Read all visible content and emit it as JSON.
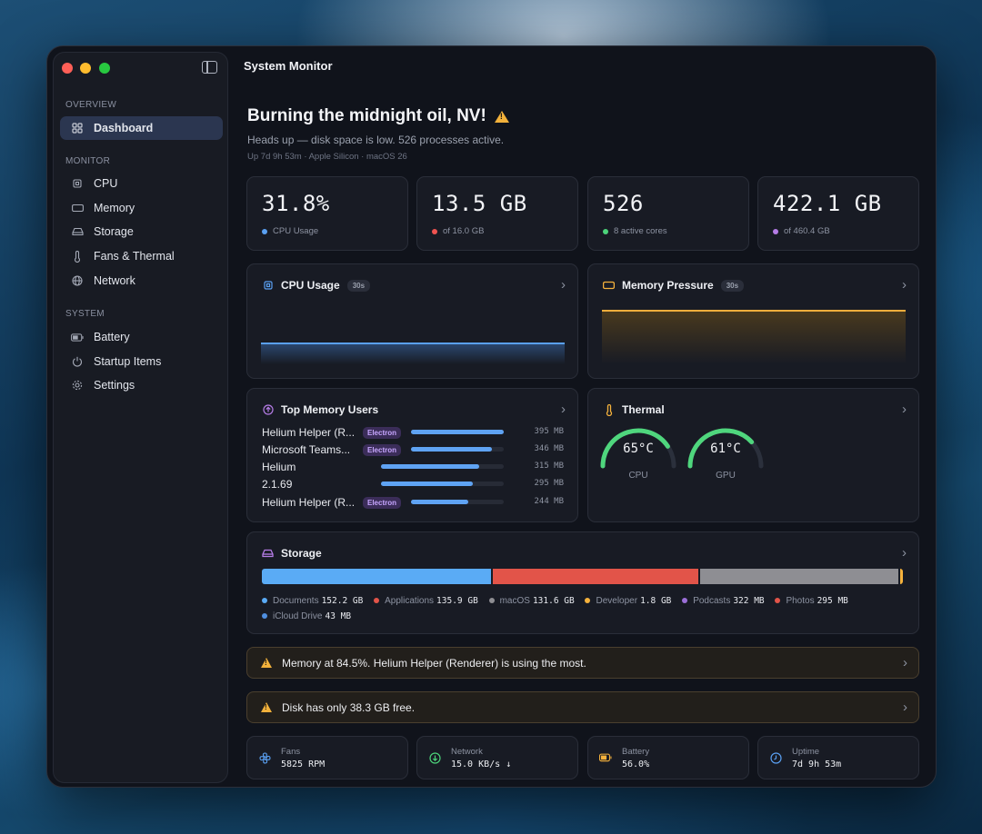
{
  "window": {
    "title": "System Monitor"
  },
  "sidebar": {
    "sections": [
      {
        "label": "OVERVIEW"
      },
      {
        "label": "MONITOR"
      },
      {
        "label": "SYSTEM"
      }
    ],
    "items": [
      {
        "label": "Dashboard",
        "icon": "grid-icon",
        "active": true
      },
      {
        "label": "CPU",
        "icon": "cpu-icon"
      },
      {
        "label": "Memory",
        "icon": "memory-icon"
      },
      {
        "label": "Storage",
        "icon": "storage-icon"
      },
      {
        "label": "Fans & Thermal",
        "icon": "thermometer-icon"
      },
      {
        "label": "Network",
        "icon": "globe-icon"
      },
      {
        "label": "Battery",
        "icon": "battery-icon"
      },
      {
        "label": "Startup Items",
        "icon": "power-icon"
      },
      {
        "label": "Settings",
        "icon": "gear-icon"
      }
    ]
  },
  "hero": {
    "title": "Burning the midnight oil, NV!",
    "subtitle": "Heads up — disk space is low. 526 processes active.",
    "meta": "Up 7d 9h 53m · Apple Silicon · macOS 26"
  },
  "stats": [
    {
      "value": "31.8%",
      "label": "CPU Usage",
      "color": "#5aa0f2"
    },
    {
      "value": "13.5 GB",
      "label": "of 16.0 GB",
      "color": "#ef5350"
    },
    {
      "value": "526",
      "label": "8 active cores",
      "color": "#4cd37a"
    },
    {
      "value": "422.1 GB",
      "label": "of 460.4 GB",
      "color": "#b57ce6"
    }
  ],
  "cpu_card": {
    "title": "CPU Usage",
    "window": "30s",
    "level": 0.318
  },
  "memory_card": {
    "title": "Memory Pressure",
    "window": "30s",
    "level": 0.845
  },
  "top_memory": {
    "title": "Top Memory Users",
    "rows": [
      {
        "name": "Helium Helper (R...",
        "tag": "Electron",
        "mb": "395 MB",
        "fraction": 1.0
      },
      {
        "name": "Microsoft Teams...",
        "tag": "Electron",
        "mb": "346 MB",
        "fraction": 0.876
      },
      {
        "name": "Helium",
        "tag": "",
        "mb": "315 MB",
        "fraction": 0.797
      },
      {
        "name": "2.1.69",
        "tag": "",
        "mb": "295 MB",
        "fraction": 0.747
      },
      {
        "name": "Helium Helper (R...",
        "tag": "Electron",
        "mb": "244 MB",
        "fraction": 0.618
      }
    ]
  },
  "thermal": {
    "title": "Thermal",
    "gauges": [
      {
        "value": "65°C",
        "label": "CPU",
        "fraction": 0.65
      },
      {
        "value": "61°C",
        "label": "GPU",
        "fraction": 0.61
      }
    ]
  },
  "storage": {
    "title": "Storage",
    "segments": [
      {
        "name": "Documents",
        "value": "152.2 GB",
        "gb": 152.2,
        "color": "#5aabf5"
      },
      {
        "name": "Applications",
        "value": "135.9 GB",
        "gb": 135.9,
        "color": "#e25449"
      },
      {
        "name": "macOS",
        "value": "131.6 GB",
        "gb": 131.6,
        "color": "#8e8e93"
      },
      {
        "name": "Developer",
        "value": "1.8 GB",
        "gb": 1.8,
        "color": "#f5b23c"
      },
      {
        "name": "Podcasts",
        "value": "322 MB",
        "gb": 0.322,
        "color": "#9b6fd8"
      },
      {
        "name": "Photos",
        "value": "295 MB",
        "gb": 0.295,
        "color": "#e25449"
      },
      {
        "name": "iCloud Drive",
        "value": "43 MB",
        "gb": 0.043,
        "color": "#4f8fe0"
      }
    ]
  },
  "alerts": [
    {
      "text": "Memory at 84.5%. Helium Helper (Renderer) is using the most."
    },
    {
      "text": "Disk has only 38.3 GB free."
    }
  ],
  "minis": [
    {
      "label": "Fans",
      "value": "5825 RPM",
      "icon": "fan-icon",
      "color": "#5aa0f2"
    },
    {
      "label": "Network",
      "value": "15.0 KB/s ↓",
      "icon": "download-icon",
      "color": "#4cd37a"
    },
    {
      "label": "Battery",
      "value": "56.0%",
      "icon": "battery-icon",
      "color": "#f5b23c"
    },
    {
      "label": "Uptime",
      "value": "7d 9h 53m",
      "icon": "clock-icon",
      "color": "#5aa0f2"
    }
  ]
}
